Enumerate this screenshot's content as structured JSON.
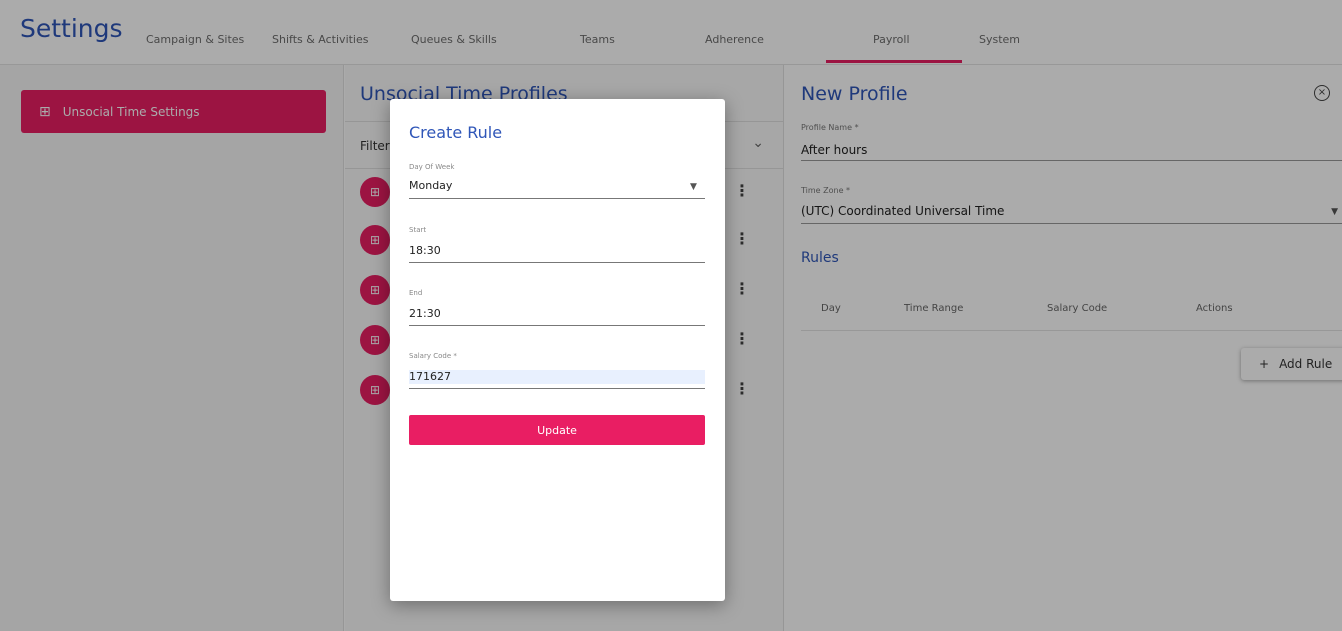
{
  "app": {
    "title": "Settings"
  },
  "nav": {
    "tabs": [
      {
        "label": "Campaign & Sites"
      },
      {
        "label": "Shifts & Activities"
      },
      {
        "label": "Queues & Skills"
      },
      {
        "label": "Teams"
      },
      {
        "label": "Adherence"
      },
      {
        "label": "Payroll",
        "active": true
      },
      {
        "label": "System"
      }
    ]
  },
  "sidebar": {
    "items": [
      {
        "label": "Unsocial Time Settings",
        "icon": "settings-grid-icon",
        "active": true
      }
    ]
  },
  "profiles_panel": {
    "title": "Unsocial Time Profiles",
    "filter_label": "Filter",
    "rows": 5
  },
  "profile_form": {
    "title": "New Profile",
    "profile_name": {
      "label": "Profile Name *",
      "value": "After hours"
    },
    "time_zone": {
      "label": "Time Zone *",
      "value": "(UTC) Coordinated Universal Time"
    },
    "rules_title": "Rules",
    "columns": [
      "Day",
      "Time Range",
      "Salary Code",
      "Actions"
    ],
    "add_rule_label": "Add Rule"
  },
  "modal": {
    "title": "Create Rule",
    "day_of_week": {
      "label": "Day Of Week",
      "value": "Monday"
    },
    "start": {
      "label": "Start",
      "value": "18:30"
    },
    "end": {
      "label": "End",
      "value": "21:30"
    },
    "salary_code": {
      "label": "Salary Code *",
      "value": "171627"
    },
    "update_label": "Update"
  },
  "colors": {
    "accent": "#e91e63",
    "title_blue": "#2f56b8"
  }
}
